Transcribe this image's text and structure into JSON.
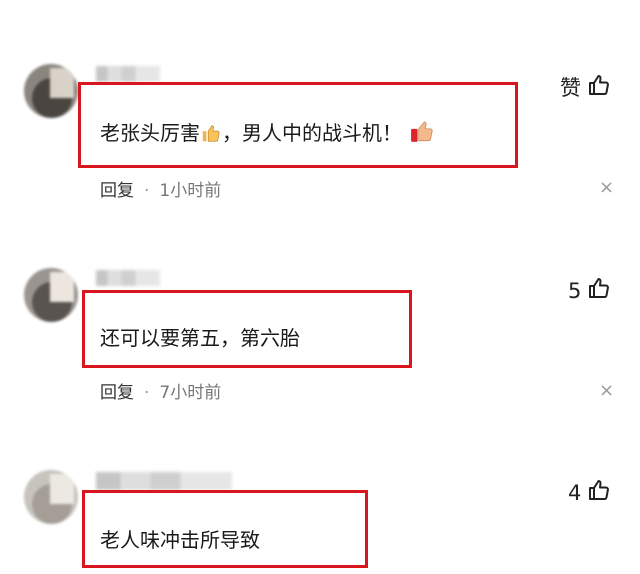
{
  "comments": [
    {
      "text_before": "老张头厉害",
      "text_after": "，男人中的战斗机！",
      "reply_label": "回复",
      "separator": "·",
      "time": "1小时前",
      "like_count": "赞",
      "close": "×"
    },
    {
      "text": "还可以要第五，第六胎",
      "reply_label": "回复",
      "separator": "·",
      "time": "7小时前",
      "like_count": "5",
      "close": "×"
    },
    {
      "text": "老人味冲击所导致",
      "like_count": "4"
    }
  ],
  "colors": {
    "highlight_border": "#d9161e",
    "text": "#1a1a1a",
    "meta_time": "#777777"
  },
  "icons": [
    "thumbs-up-emoji",
    "thumbs-up-icon",
    "close-icon"
  ]
}
